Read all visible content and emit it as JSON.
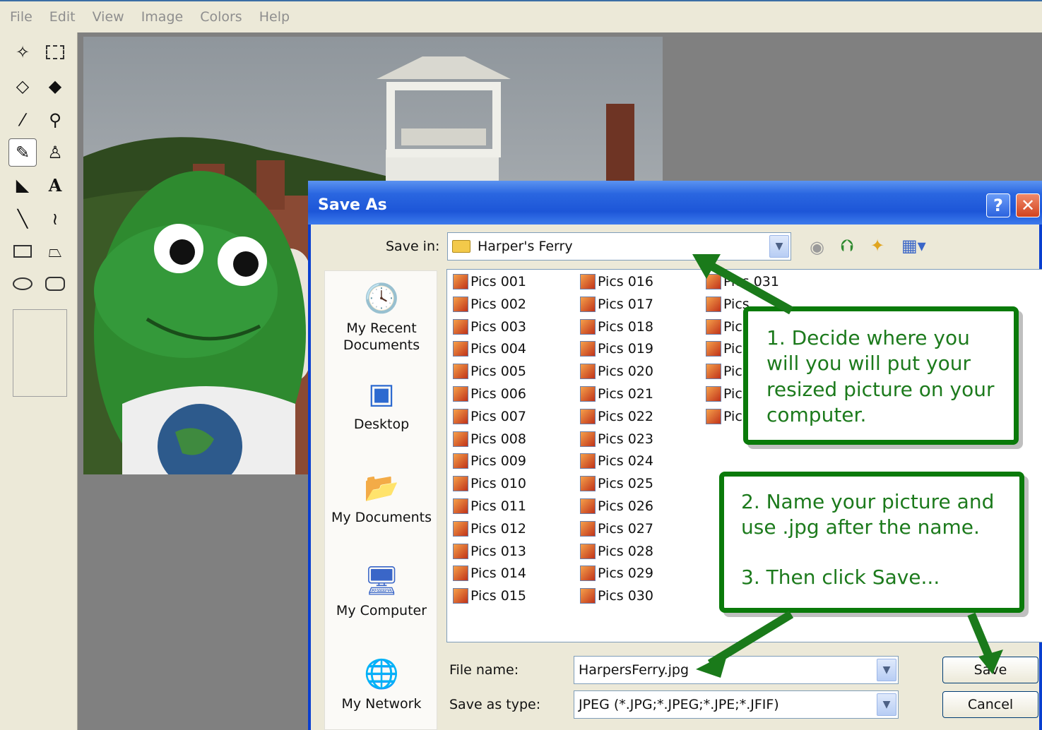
{
  "menu": [
    "File",
    "Edit",
    "View",
    "Image",
    "Colors",
    "Help"
  ],
  "dialog": {
    "title": "Save As",
    "help_btn": "?",
    "close_btn": "✕",
    "save_in_label": "Save in:",
    "save_in_value": "Harper's Ferry",
    "file_name_label": "File name:",
    "file_name_value": "HarpersFerry.jpg",
    "save_type_label": "Save as type:",
    "save_type_value": "JPEG (*.JPG;*.JPEG;*.JPE;*.JFIF)",
    "save_btn": "Save",
    "cancel_btn": "Cancel",
    "places": [
      "My Recent\nDocuments",
      "Desktop",
      "My Documents",
      "My Computer",
      "My Network"
    ],
    "files_col1": [
      "Pics 001",
      "Pics 002",
      "Pics 003",
      "Pics 004",
      "Pics 005",
      "Pics 006",
      "Pics 007",
      "Pics 008",
      "Pics 009",
      "Pics 010",
      "Pics 011",
      "Pics 012",
      "Pics 013",
      "Pics 014",
      "Pics 015"
    ],
    "files_col2": [
      "Pics 016",
      "Pics 017",
      "Pics 018",
      "Pics 019",
      "Pics 020",
      "Pics 021",
      "Pics 022",
      "Pics 023",
      "Pics 024",
      "Pics 025",
      "Pics 026",
      "Pics 027",
      "Pics 028",
      "Pics 029",
      "Pics 030"
    ],
    "files_col3": [
      "Pics 031",
      "Pics",
      "Pic",
      "Pic",
      "Pic",
      "Pic",
      "Pic"
    ]
  },
  "callouts": {
    "one": "1.  Decide where you will you will put your resized picture on your computer.",
    "two_a": "2. Name your picture and use .jpg after the name.",
    "two_b": "3. Then click Save..."
  },
  "colors": {
    "callout_border": "#0a7a0a",
    "callout_text": "#1c7a1c",
    "title_bar": "#2a66e0"
  }
}
